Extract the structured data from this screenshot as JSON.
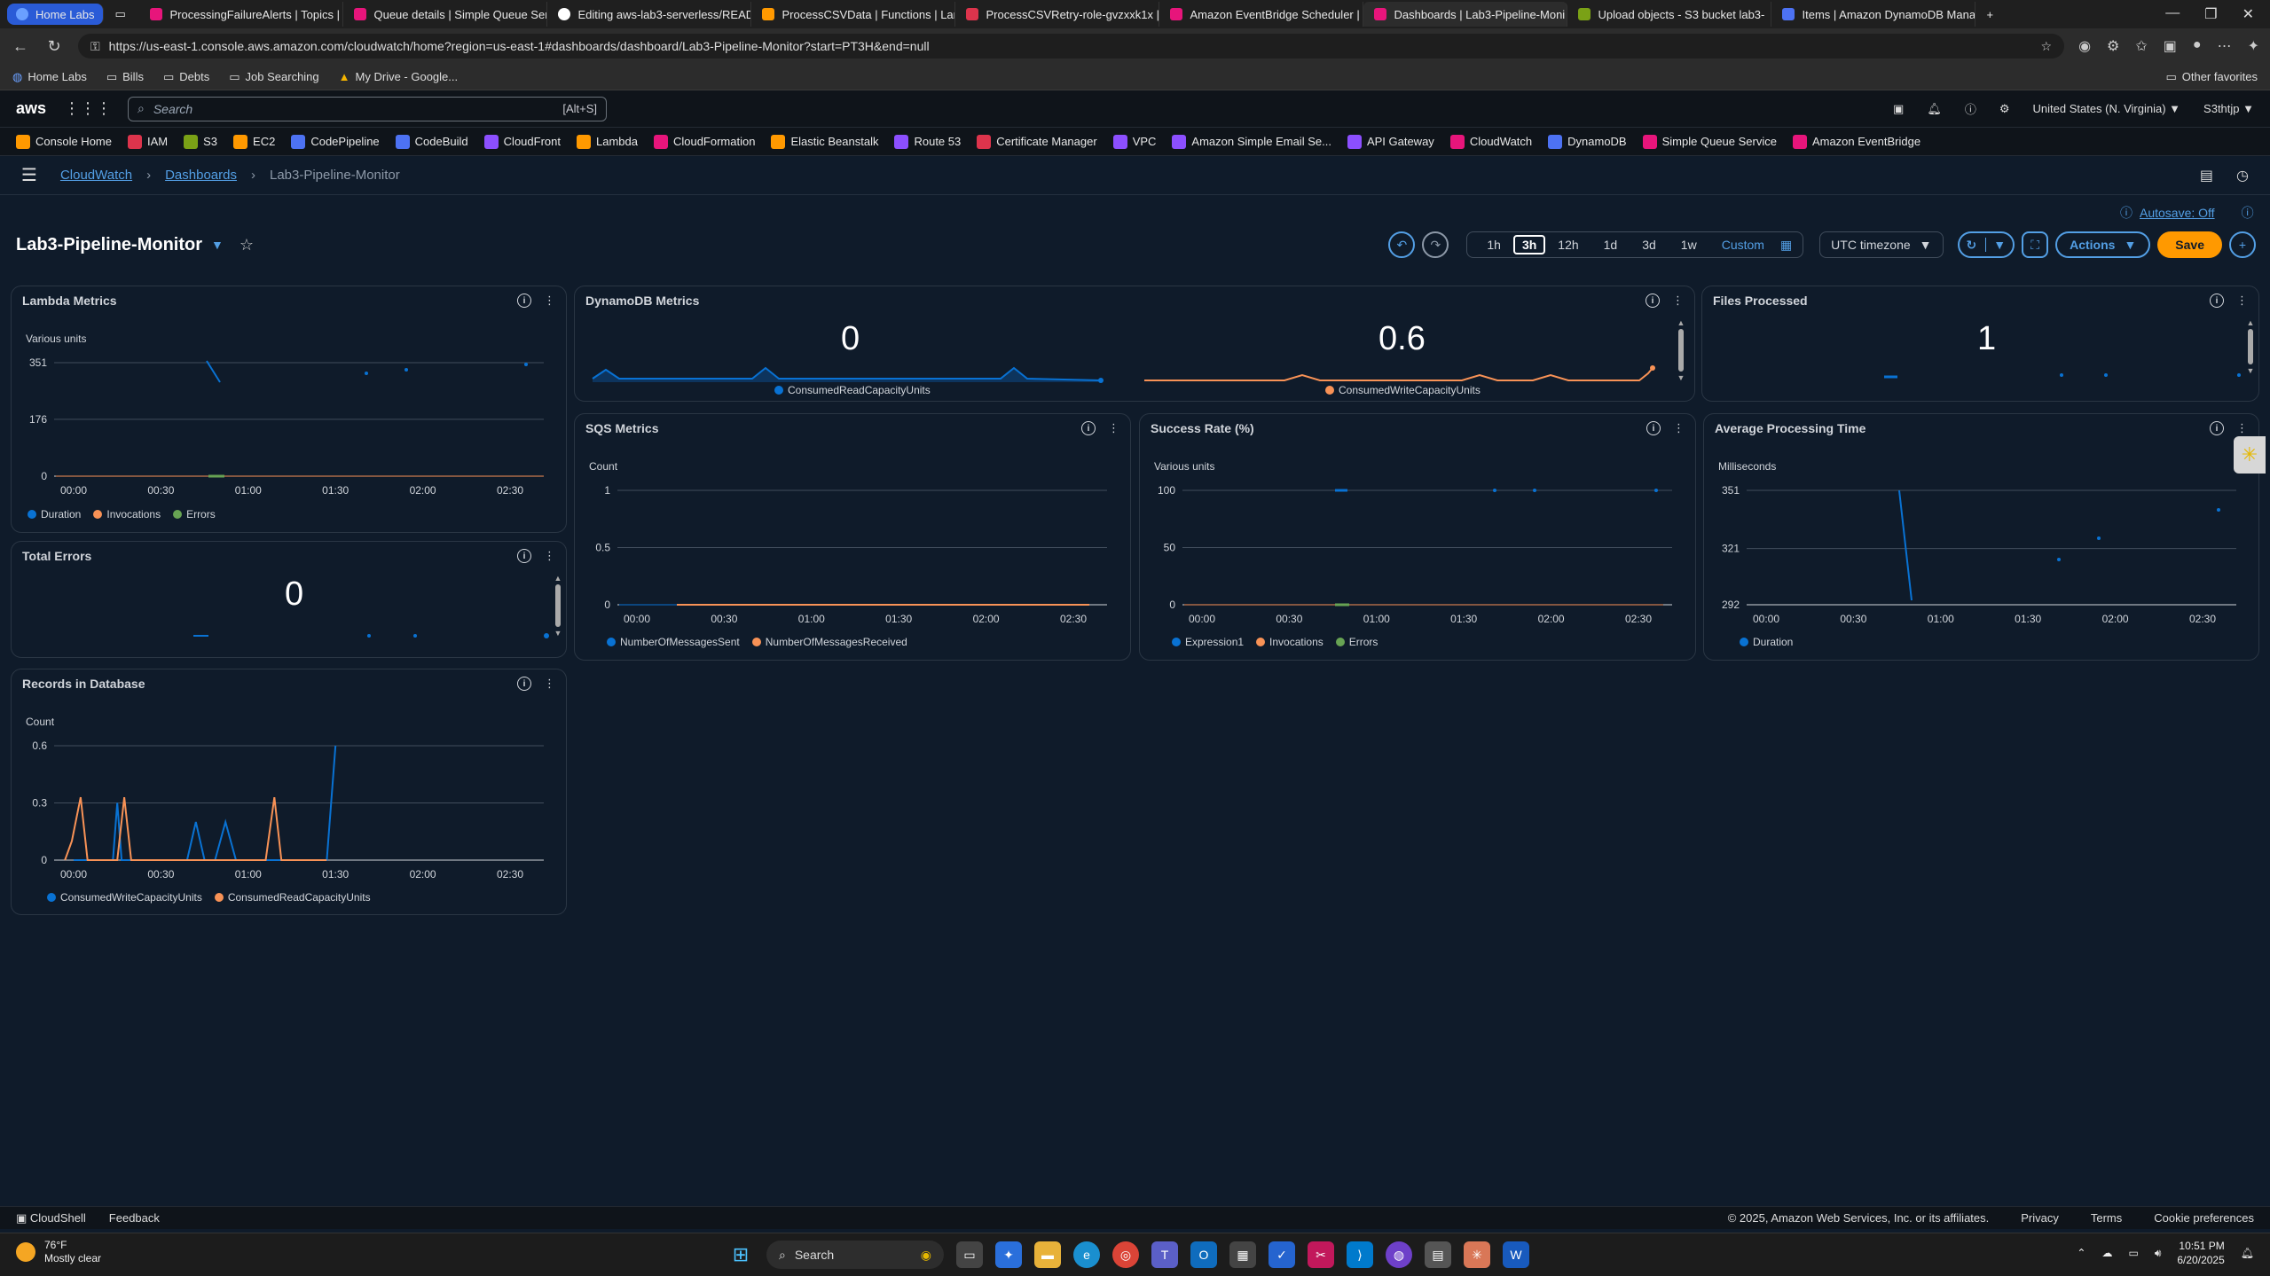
{
  "browser": {
    "tabs": [
      {
        "label": "Home Labs",
        "color": "#2a5bd7"
      },
      {
        "label": "ProcessingFailureAlerts | Topics | S",
        "color": "#e7157b"
      },
      {
        "label": "Queue details | Simple Queue Serv",
        "color": "#e7157b"
      },
      {
        "label": "Editing aws-lab3-serverless/READ",
        "color": "#ffffff"
      },
      {
        "label": "ProcessCSVData | Functions | Lam",
        "color": "#ff9900"
      },
      {
        "label": "ProcessCSVRetry-role-gvzxxk1x |",
        "color": "#dd344c"
      },
      {
        "label": "Amazon EventBridge Scheduler |",
        "color": "#e7157b"
      },
      {
        "label": "Dashboards | Lab3-Pipeline-Moni",
        "color": "#e7157b"
      },
      {
        "label": "Upload objects - S3 bucket lab3-",
        "color": "#7aa116"
      },
      {
        "label": "Items | Amazon DynamoDB Mana",
        "color": "#4d72f3"
      }
    ],
    "url": "https://us-east-1.console.aws.amazon.com/cloudwatch/home?region=us-east-1#dashboards/dashboard/Lab3-Pipeline-Monitor?start=PT3H&end=null",
    "bookmarks": [
      "Home Labs",
      "Bills",
      "Debts",
      "Job Searching",
      "My Drive - Google..."
    ],
    "other_favorites": "Other favorites"
  },
  "aws": {
    "logo": "aws",
    "search_placeholder": "Search",
    "search_shortcut": "[Alt+S]",
    "region": "United States (N. Virginia) ▼",
    "account": "S3thtjp ▼",
    "services": [
      {
        "label": "Console Home",
        "color": "#ff9900"
      },
      {
        "label": "IAM",
        "color": "#dd344c"
      },
      {
        "label": "S3",
        "color": "#7aa116"
      },
      {
        "label": "EC2",
        "color": "#ff9900"
      },
      {
        "label": "CodePipeline",
        "color": "#4d72f3"
      },
      {
        "label": "CodeBuild",
        "color": "#4d72f3"
      },
      {
        "label": "CloudFront",
        "color": "#8c4fff"
      },
      {
        "label": "Lambda",
        "color": "#ff9900"
      },
      {
        "label": "CloudFormation",
        "color": "#e7157b"
      },
      {
        "label": "Elastic Beanstalk",
        "color": "#ff9900"
      },
      {
        "label": "Route 53",
        "color": "#8c4fff"
      },
      {
        "label": "Certificate Manager",
        "color": "#dd344c"
      },
      {
        "label": "VPC",
        "color": "#8c4fff"
      },
      {
        "label": "Amazon Simple Email Se...",
        "color": "#8c4fff"
      },
      {
        "label": "API Gateway",
        "color": "#8c4fff"
      },
      {
        "label": "CloudWatch",
        "color": "#e7157b"
      },
      {
        "label": "DynamoDB",
        "color": "#4d72f3"
      },
      {
        "label": "Simple Queue Service",
        "color": "#e7157b"
      },
      {
        "label": "Amazon EventBridge",
        "color": "#e7157b"
      }
    ]
  },
  "breadcrumb": {
    "root": "CloudWatch",
    "section": "Dashboards",
    "current": "Lab3-Pipeline-Monitor"
  },
  "dashboard": {
    "title": "Lab3-Pipeline-Monitor",
    "autosave": "Autosave: Off",
    "ranges": [
      "1h",
      "3h",
      "12h",
      "1d",
      "3d",
      "1w"
    ],
    "selected_range": "3h",
    "custom": "Custom",
    "timezone": "UTC timezone",
    "actions": "Actions",
    "save": "Save"
  },
  "widgets": {
    "lambda": {
      "title": "Lambda Metrics",
      "unit": "Various units"
    },
    "dynamo": {
      "title": "DynamoDB Metrics",
      "read_value": "0",
      "write_value": "0.6"
    },
    "files": {
      "title": "Files Processed",
      "value": "1"
    },
    "sqs": {
      "title": "SQS Metrics",
      "unit": "Count"
    },
    "success": {
      "title": "Success Rate (%)",
      "unit": "Various units"
    },
    "avgtime": {
      "title": "Average Processing Time",
      "unit": "Milliseconds"
    },
    "errors": {
      "title": "Total Errors",
      "value": "0"
    },
    "records": {
      "title": "Records in Database",
      "unit": "Count"
    }
  },
  "chart_data": [
    {
      "type": "line",
      "title": "Lambda Metrics",
      "ylabel": "Various units",
      "x_ticks": [
        "00:00",
        "00:30",
        "01:00",
        "01:30",
        "02:00",
        "02:30"
      ],
      "y_ticks": [
        0,
        176,
        351
      ],
      "ylim": [
        0,
        351
      ],
      "series": [
        {
          "name": "Duration",
          "color": "#0972d3"
        },
        {
          "name": "Invocations",
          "color": "#f89256"
        },
        {
          "name": "Errors",
          "color": "#67a353"
        }
      ]
    },
    {
      "type": "line",
      "title": "SQS Metrics",
      "ylabel": "Count",
      "x_ticks": [
        "00:00",
        "00:30",
        "01:00",
        "01:30",
        "02:00",
        "02:30"
      ],
      "y_ticks": [
        0,
        0.5,
        1
      ],
      "ylim": [
        0,
        1
      ],
      "series": [
        {
          "name": "NumberOfMessagesSent",
          "color": "#0972d3"
        },
        {
          "name": "NumberOfMessagesReceived",
          "color": "#f89256"
        }
      ]
    },
    {
      "type": "line",
      "title": "Success Rate (%)",
      "ylabel": "Various units",
      "x_ticks": [
        "00:00",
        "00:30",
        "01:00",
        "01:30",
        "02:00",
        "02:30"
      ],
      "y_ticks": [
        0,
        50,
        100
      ],
      "ylim": [
        0,
        100
      ],
      "series": [
        {
          "name": "Expression1",
          "color": "#0972d3"
        },
        {
          "name": "Invocations",
          "color": "#f89256"
        },
        {
          "name": "Errors",
          "color": "#67a353"
        }
      ]
    },
    {
      "type": "line",
      "title": "Average Processing Time",
      "ylabel": "Milliseconds",
      "x_ticks": [
        "00:00",
        "00:30",
        "01:00",
        "01:30",
        "02:00",
        "02:30"
      ],
      "y_ticks": [
        292,
        321,
        351
      ],
      "ylim": [
        292,
        351
      ],
      "series": [
        {
          "name": "Duration",
          "color": "#0972d3"
        }
      ]
    },
    {
      "type": "line",
      "title": "Records in Database",
      "ylabel": "Count",
      "x_ticks": [
        "00:00",
        "00:30",
        "01:00",
        "01:30",
        "02:00",
        "02:30"
      ],
      "y_ticks": [
        0,
        0.3,
        0.6
      ],
      "ylim": [
        0,
        0.6
      ],
      "series": [
        {
          "name": "ConsumedWriteCapacityUnits",
          "color": "#0972d3",
          "points": [
            [
              0,
              0
            ],
            [
              0.08,
              0
            ],
            [
              0.45,
              0
            ],
            [
              0.5,
              0.3
            ],
            [
              0.55,
              0
            ],
            [
              1.3,
              0
            ],
            [
              1.4,
              0.2
            ],
            [
              1.5,
              0
            ],
            [
              1.62,
              0
            ],
            [
              1.74,
              0.2
            ],
            [
              1.86,
              0
            ],
            [
              2.9,
              0
            ],
            [
              3.0,
              0.6
            ]
          ]
        },
        {
          "name": "ConsumedReadCapacityUnits",
          "color": "#f89256",
          "points": [
            [
              -0.1,
              0
            ],
            [
              -0.02,
              0.1
            ],
            [
              0.08,
              0.33
            ],
            [
              0.16,
              0
            ],
            [
              0.5,
              0
            ],
            [
              0.58,
              0.33
            ],
            [
              0.66,
              0
            ],
            [
              2.2,
              0
            ],
            [
              2.3,
              0.33
            ],
            [
              2.38,
              0
            ],
            [
              2.9,
              0
            ]
          ]
        }
      ]
    }
  ],
  "footer": {
    "cloudshell": "CloudShell",
    "feedback": "Feedback",
    "copyright": "© 2025, Amazon Web Services, Inc. or its affiliates.",
    "privacy": "Privacy",
    "terms": "Terms",
    "cookies": "Cookie preferences"
  },
  "taskbar": {
    "temp": "76°F",
    "weather": "Mostly clear",
    "search": "Search",
    "time": "10:51 PM",
    "date": "6/20/2025"
  }
}
